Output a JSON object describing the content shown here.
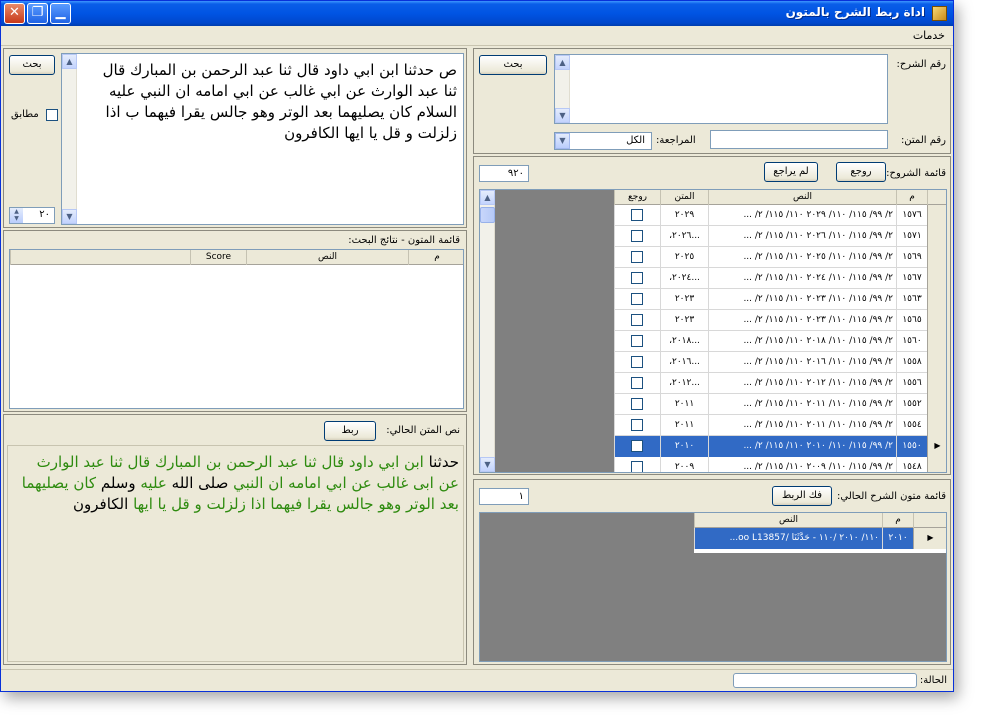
{
  "window": {
    "title": "اداة ربط الشرح بالمتون",
    "close_glyph": "✕",
    "max_glyph": "❐",
    "min_glyph": "▁"
  },
  "menu": {
    "items": [
      "خدمات"
    ]
  },
  "sharh_panel": {
    "sharh_no_label": "رقم الشرح:",
    "search_btn": "بحث",
    "matn_no_label": "رقم المتن:",
    "review_label": "المراجعة:",
    "review_value": "الكل"
  },
  "shuruh_list": {
    "label": "قائمة الشروح:",
    "reviewed_btn": "روجع",
    "not_reviewed_btn": "لم يراجع",
    "count": "٩٢٠",
    "columns": [
      "م",
      "النص",
      "المتن",
      "روجع"
    ],
    "rows": [
      {
        "m": "١٥٧٦",
        "nass": "٢/ ٩٩/ ١١٥/ ١١٠/ ٢٠٢٩ ١١٠/ ١١٥/ ٢/ ...",
        "matn": "٢٠٢٩"
      },
      {
        "m": "١٥٧١",
        "nass": "٢/ ٩٩/ ١١٥/ ١١٠/ ٢٠٢٦ ١١٠/ ١١٥/ ٢/ ...",
        "matn": "...٢٠٢٦،"
      },
      {
        "m": "١٥٦٩",
        "nass": "٢/ ٩٩/ ١١٥/ ١١٠/ ٢٠٢٥ ١١٠/ ١١٥/ ٢/ ...",
        "matn": "٢٠٢٥"
      },
      {
        "m": "١٥٦٧",
        "nass": "٢/ ٩٩/ ١١٥/ ١١٠/ ٢٠٢٤ ١١٠/ ١١٥/ ٢/ ...",
        "matn": "...٢٠٢٤،"
      },
      {
        "m": "١٥٦٣",
        "nass": "٢/ ٩٩/ ١١٥/ ١١٠/ ٢٠٢٣ ١١٠/ ١١٥/ ٢/ ...",
        "matn": "٢٠٢٣"
      },
      {
        "m": "١٥٦٥",
        "nass": "٢/ ٩٩/ ١١٥/ ١١٠/ ٢٠٢٣ ١١٠/ ١١٥/ ٢/ ...",
        "matn": "٢٠٢٣"
      },
      {
        "m": "١٥٦٠",
        "nass": "٢/ ٩٩/ ١١٥/ ١١٠/ ٢٠١٨ ١١٠/ ١١٥/ ٢/ ...",
        "matn": "...٢٠١٨،"
      },
      {
        "m": "١٥٥٨",
        "nass": "٢/ ٩٩/ ١١٥/ ١١٠/ ٢٠١٦ ١١٠/ ١١٥/ ٢/ ...",
        "matn": "...٢٠١٦،"
      },
      {
        "m": "١٥٥٦",
        "nass": "٢/ ٩٩/ ١١٥/ ١١٠/ ٢٠١٢ ١١٠/ ١١٥/ ٢/ ...",
        "matn": "...٢٠١٢،"
      },
      {
        "m": "١٥٥٢",
        "nass": "٢/ ٩٩/ ١١٥/ ١١٠/ ٢٠١١ ١١٠/ ١١٥/ ٢/ ...",
        "matn": "٢٠١١"
      },
      {
        "m": "١٥٥٤",
        "nass": "٢/ ٩٩/ ١١٥/ ١١٠/ ٢٠١١ ١١٠/ ١١٥/ ٢/ ...",
        "matn": "٢٠١١"
      },
      {
        "m": "١٥٥٠",
        "nass": "٢/ ٩٩/ ١١٥/ ١١٠/ ٢٠١٠ ١١٠/ ١١٥/ ٢/ ...",
        "matn": "٢٠١٠",
        "selected": true
      },
      {
        "m": "١٥٤٨",
        "nass": "٢/ ٩٩/ ١١٥/ ١١٠/ ٢٠٠٩ ١١٠/ ١١٥/ ٢/ ...",
        "matn": "٢٠٠٩"
      }
    ]
  },
  "current_links": {
    "label": "قائمة متون الشرح الحالي:",
    "unlink_btn": "فك الربط",
    "count": "١",
    "columns": [
      "م",
      "النص"
    ],
    "rows": [
      {
        "m": "٢٠١٠",
        "nass": "١١٠/ ٢٠١٠ /١١٠ - حَدَّثَنَا /oo L13857..."
      }
    ]
  },
  "status": {
    "label": "الحالة:"
  },
  "search_panel": {
    "search_btn": "بحث",
    "match_label": "مطابق",
    "spinner_value": "٢٠",
    "text": "ص حدثنا ابن ابي داود قال ثنا عبد الرحمن بن المبارك قال ثنا عبد الوارث عن ابي غالب عن ابي امامه ان النبي عليه السلام كان يصليهما بعد الوتر وهو جالس يقرا فيهما ب اذا زلزلت و قل يا ايها الكافرون"
  },
  "results_panel": {
    "label": "قائمة المتون - نتائج البحث:",
    "columns": [
      "م",
      "النص",
      "Score"
    ]
  },
  "current_text_panel": {
    "label": "نص المتن الحالي:",
    "link_btn": "ربط",
    "segments": [
      {
        "t": "حدثنا ",
        "c": "#000000"
      },
      {
        "t": "ابن ابي داود قال ثنا عبد الرحمن بن المبارك قال ثنا عبد الوارث عن ابى غالب عن ابي امامه ان النبي ",
        "c": "#2e8b0f"
      },
      {
        "t": "صلى الله",
        "c": "#000000"
      },
      {
        "t": " عليه ",
        "c": "#2e8b0f"
      },
      {
        "t": "وسلم",
        "c": "#000000"
      },
      {
        "t": " كان يصليهما بعد الوتر وهو جالس يقرا فيهما اذا زلزلت و قل يا ايها ",
        "c": "#2e8b0f"
      },
      {
        "t": "الكافرون",
        "c": "#000000"
      }
    ]
  }
}
